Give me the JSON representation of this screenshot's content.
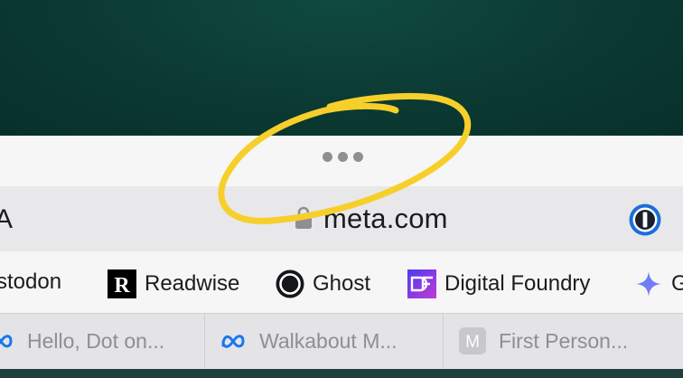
{
  "address": {
    "left_fragment": "A",
    "url": "meta.com"
  },
  "favorites": [
    {
      "label": "stodon",
      "icon": "mastodon-icon"
    },
    {
      "label": "Readwise",
      "icon": "readwise-icon"
    },
    {
      "label": "Ghost",
      "icon": "ghost-icon"
    },
    {
      "label": "Digital Foundry",
      "icon": "digital-foundry-icon"
    },
    {
      "label": "G",
      "icon": "gemini-sparkle-icon"
    }
  ],
  "tabs": [
    {
      "title": "Hello, Dot on...",
      "icon": "meta-icon"
    },
    {
      "title": "Walkabout M...",
      "icon": "meta-icon"
    },
    {
      "title": "First Person...",
      "icon": "m-letter-icon",
      "icon_letter": "M"
    }
  ],
  "colors": {
    "annotation": "#f7cf2b",
    "wallpaper": "#0b3a33",
    "meta_blue": "#1877f2",
    "onepassword_blue": "#1a6ed8"
  }
}
